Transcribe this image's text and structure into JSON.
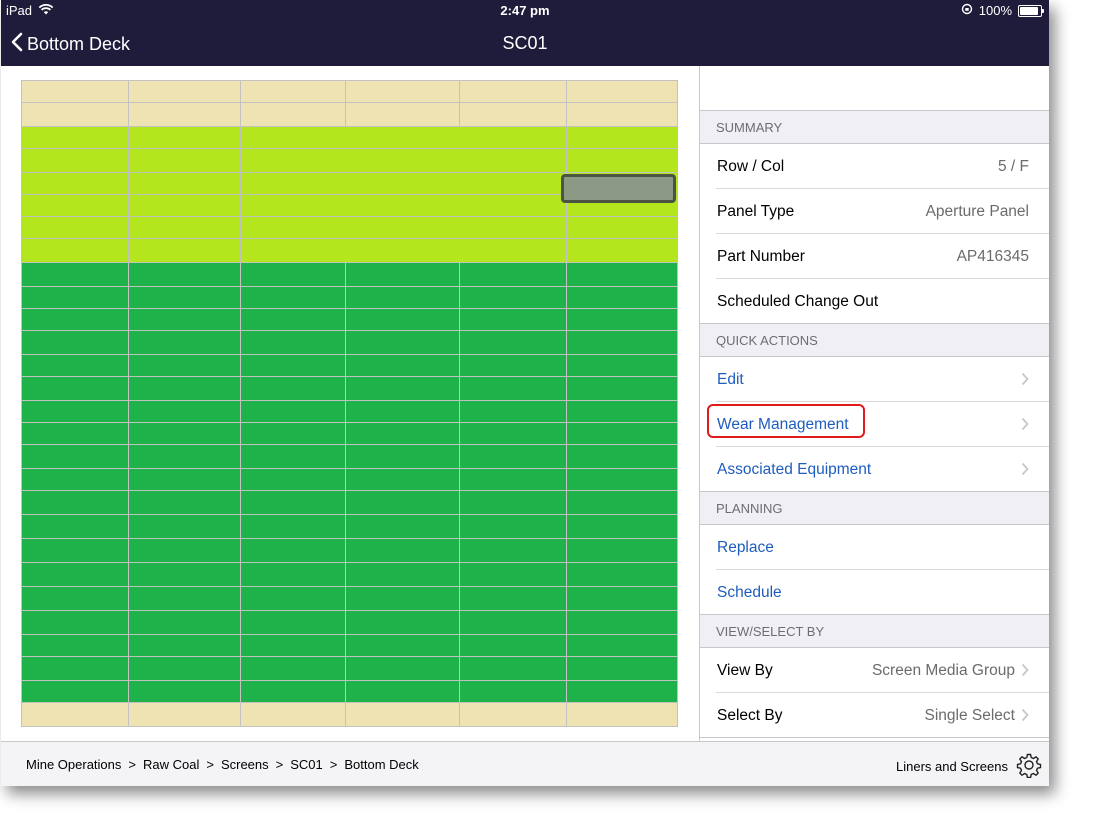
{
  "status_bar": {
    "device": "iPad",
    "time": "2:47 pm",
    "battery": "100%",
    "battery_level": 1.0
  },
  "nav": {
    "back_label": "Bottom Deck",
    "title": "SC01"
  },
  "grid": {
    "columns": 6,
    "rows": [
      "tan",
      "tan",
      "lime",
      "lime",
      "lime",
      "lime",
      "lime",
      "lime",
      "green",
      "green",
      "green",
      "green",
      "green",
      "green",
      "green",
      "green",
      "green",
      "green",
      "green",
      "green",
      "green",
      "green",
      "green",
      "green",
      "green",
      "green",
      "green",
      "tan"
    ],
    "colors": {
      "tan": "#efe3b4",
      "lime": "#b4e61d",
      "green": "#20b24a",
      "selected": "#8c9a85"
    },
    "selected": {
      "row": 5,
      "col": "F"
    }
  },
  "summary": {
    "header": "SUMMARY",
    "rows": [
      {
        "label": "Row / Col",
        "value": "5 / F"
      },
      {
        "label": "Panel Type",
        "value": "Aperture Panel"
      },
      {
        "label": "Part Number",
        "value": "AP416345"
      },
      {
        "label": "Scheduled Change Out",
        "value": ""
      }
    ]
  },
  "quick_actions": {
    "header": "QUICK ACTIONS",
    "items": [
      {
        "label": "Edit"
      },
      {
        "label": "Wear Management"
      },
      {
        "label": "Associated Equipment"
      }
    ]
  },
  "planning": {
    "header": "PLANNING",
    "items": [
      {
        "label": "Replace"
      },
      {
        "label": "Schedule"
      }
    ]
  },
  "view_select": {
    "header": "VIEW/SELECT BY",
    "rows": [
      {
        "label": "View By",
        "value": "Screen Media Group"
      },
      {
        "label": "Select By",
        "value": "Single Select"
      }
    ]
  },
  "breadcrumb": [
    "Mine Operations",
    "Raw Coal",
    "Screens",
    "SC01",
    "Bottom Deck"
  ],
  "breadcrumb_separator": ">",
  "footer": {
    "module": "Liners and Screens"
  },
  "icons": {
    "wifi": "wifi-icon",
    "back": "chevron-left-icon",
    "chevron": "chevron-right-icon",
    "settings": "gear-icon",
    "lock": "orientation-lock-icon"
  }
}
